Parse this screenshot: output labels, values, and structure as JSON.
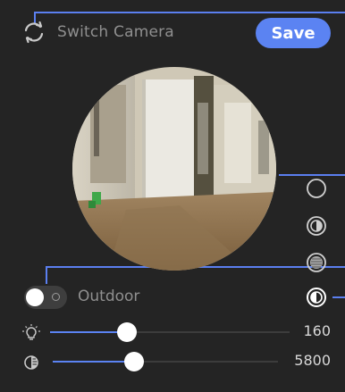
{
  "header": {
    "switch_label": "Switch Camera",
    "switch_icon": "sync-icon",
    "save_label": "Save"
  },
  "preview": {
    "description_icon": "camera-preview"
  },
  "modes": [
    {
      "icon": "circle-outline-icon"
    },
    {
      "icon": "half-contrast-icon"
    },
    {
      "icon": "striped-contrast-icon"
    },
    {
      "icon": "contrast-selected-icon"
    }
  ],
  "outdoor": {
    "label": "Outdoor",
    "enabled": false
  },
  "brightness": {
    "icon": "lightbulb-icon",
    "value": "160",
    "fraction": 0.32
  },
  "color_temp": {
    "icon": "contrast-icon",
    "value": "5800",
    "fraction": 0.36
  },
  "colors": {
    "accent": "#5b83f2",
    "background": "#242424",
    "callout_line": "#5b7ff0"
  }
}
